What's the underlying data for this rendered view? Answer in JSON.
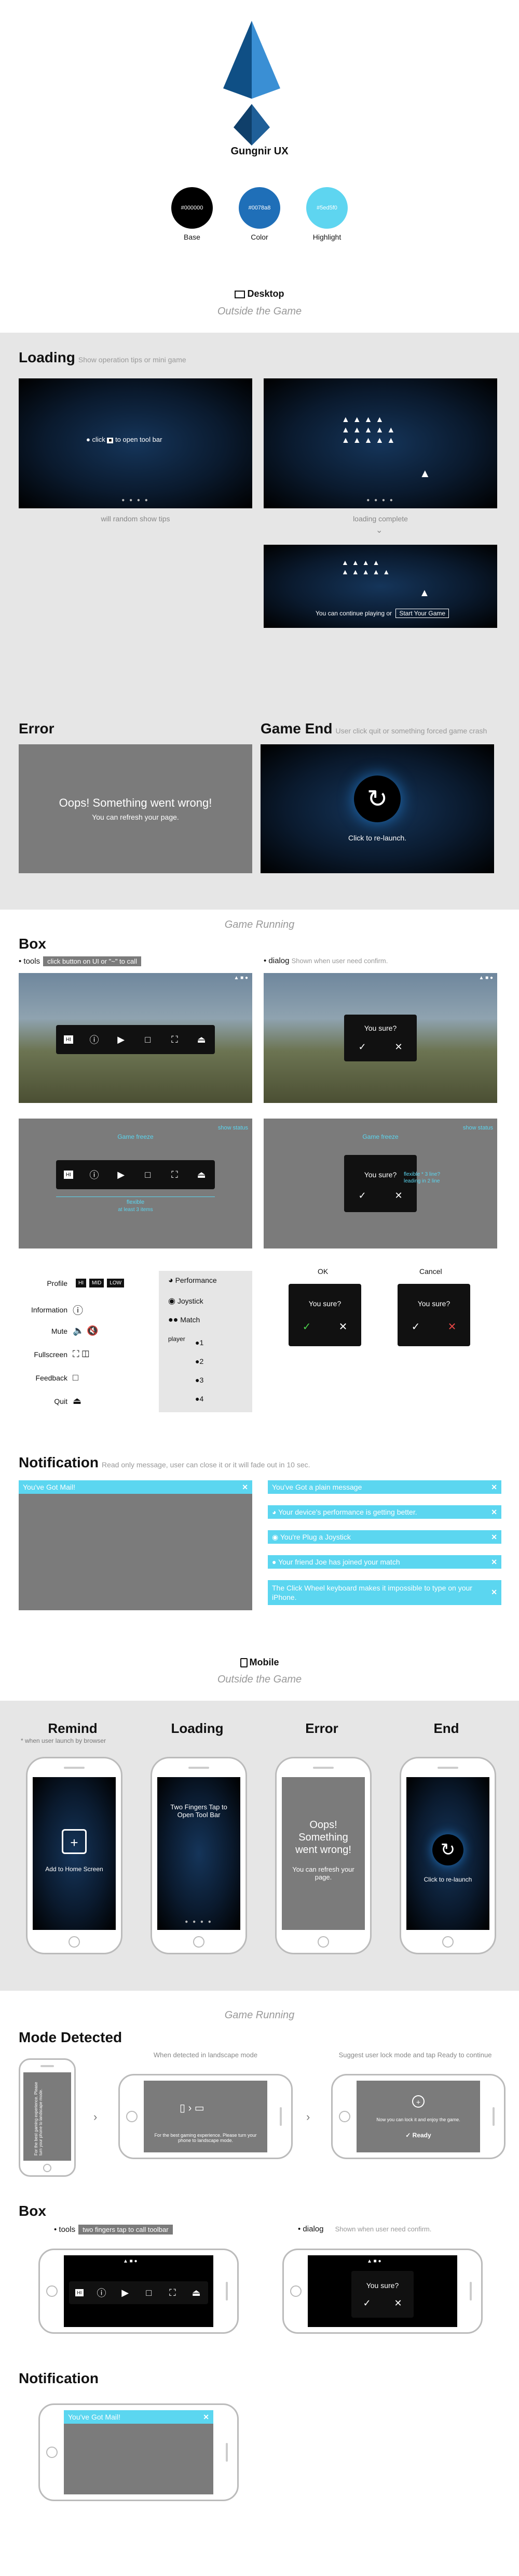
{
  "header": {
    "title": "Gungnir UX"
  },
  "palette": [
    {
      "hex": "#000000",
      "label": "Base",
      "color": "#000000"
    },
    {
      "hex": "#0078a8",
      "label": "Color",
      "color": "#1f6fb8"
    },
    {
      "hex": "#5ed5f0",
      "label": "Highlight",
      "color": "#5ed5f0"
    }
  ],
  "desktop": {
    "heading": "Desktop",
    "outside_title": "Outside the Game",
    "loading": {
      "title": "Loading",
      "sub": "Show operation tips or mini game",
      "tip_text": "click",
      "tip_text2": "to open tool bar",
      "caption_left": "will random show tips",
      "caption_right": "loading complete",
      "continue_text": "You can continue playing or",
      "start_button": "Start Your Game"
    },
    "error": {
      "title": "Error",
      "message": "Oops! Something went wrong!",
      "detail": "You can refresh your page."
    },
    "game_end": {
      "title": "Game End",
      "sub": "User click quit or something forced game crash",
      "relaunch": "Click to re-launch."
    },
    "running_title": "Game Running",
    "box": {
      "title": "Box",
      "tools_label": "tools",
      "tools_tag": "click button on UI or \"~\" to call",
      "dialog_label": "dialog",
      "dialog_sub": "Shown when user need confirm.",
      "sure": "You sure?",
      "game_freeze": "Game freeze",
      "show_status": "show status",
      "flexible": "flexible",
      "atleast": "at least 3 items",
      "flex_note1": "flexible * 3 line?",
      "flex_note2": "leading in 2 line",
      "ok": "OK",
      "cancel": "Cancel"
    },
    "legend": {
      "profile": "Profile",
      "profile_keys": [
        "HI",
        "MID",
        "LOW"
      ],
      "information": "Information",
      "mute": "Mute",
      "fullscreen": "Fullscreen",
      "feedback": "Feedback",
      "quit": "Quit",
      "performance": "Performance",
      "joystick": "Joystick",
      "match": "Match",
      "player": "player",
      "player_nums": [
        "1",
        "2",
        "3",
        "4"
      ]
    },
    "notification": {
      "title": "Notification",
      "sub": "Read only message, user can close it or it will fade out in 10 sec.",
      "mail": "You've Got Mail!",
      "plain": "You've Got a plain message",
      "device": "Your device's performance is getting better.",
      "joystick": "You're Plug a Joystick",
      "friend": "Your friend Joe has joined your match",
      "click_wheel": "The Click Wheel keyboard makes it impossible to type on your iPhone."
    }
  },
  "mobile": {
    "heading": "Mobile",
    "outside_title": "Outside the Game",
    "remind": {
      "title": "Remind",
      "note": "* when user launch by browser",
      "text": "Add to Home Screen"
    },
    "loading": {
      "title": "Loading",
      "text": "Two Fingers Tap to Open Tool Bar"
    },
    "error": {
      "title": "Error",
      "msg": "Oops! Something went wrong!",
      "detail": "You can refresh your page."
    },
    "end": {
      "title": "End",
      "text": "Click to re-launch"
    },
    "running_title": "Game Running",
    "mode": {
      "title": "Mode Detected",
      "landscape_caption": "When detected in landscape mode",
      "suggest_caption": "Suggest user lock mode and tap Ready to continue",
      "best": "For the best gaming experience. Please turn your phone to landscape mode.",
      "lock": "Now you can lock it and enjoy the game.",
      "ready": "Ready",
      "portrait_hint": "For the best gaming experience. Please turn your phone to landscape mode."
    },
    "box": {
      "title": "Box",
      "tools_label": "tools",
      "tools_tag": "two fingers tap to call toolbar",
      "dialog_label": "dialog",
      "dialog_sub": "Shown when user need confirm.",
      "sure": "You sure?"
    },
    "notification": {
      "title": "Notification",
      "mail": "You've Got Mail!"
    }
  }
}
